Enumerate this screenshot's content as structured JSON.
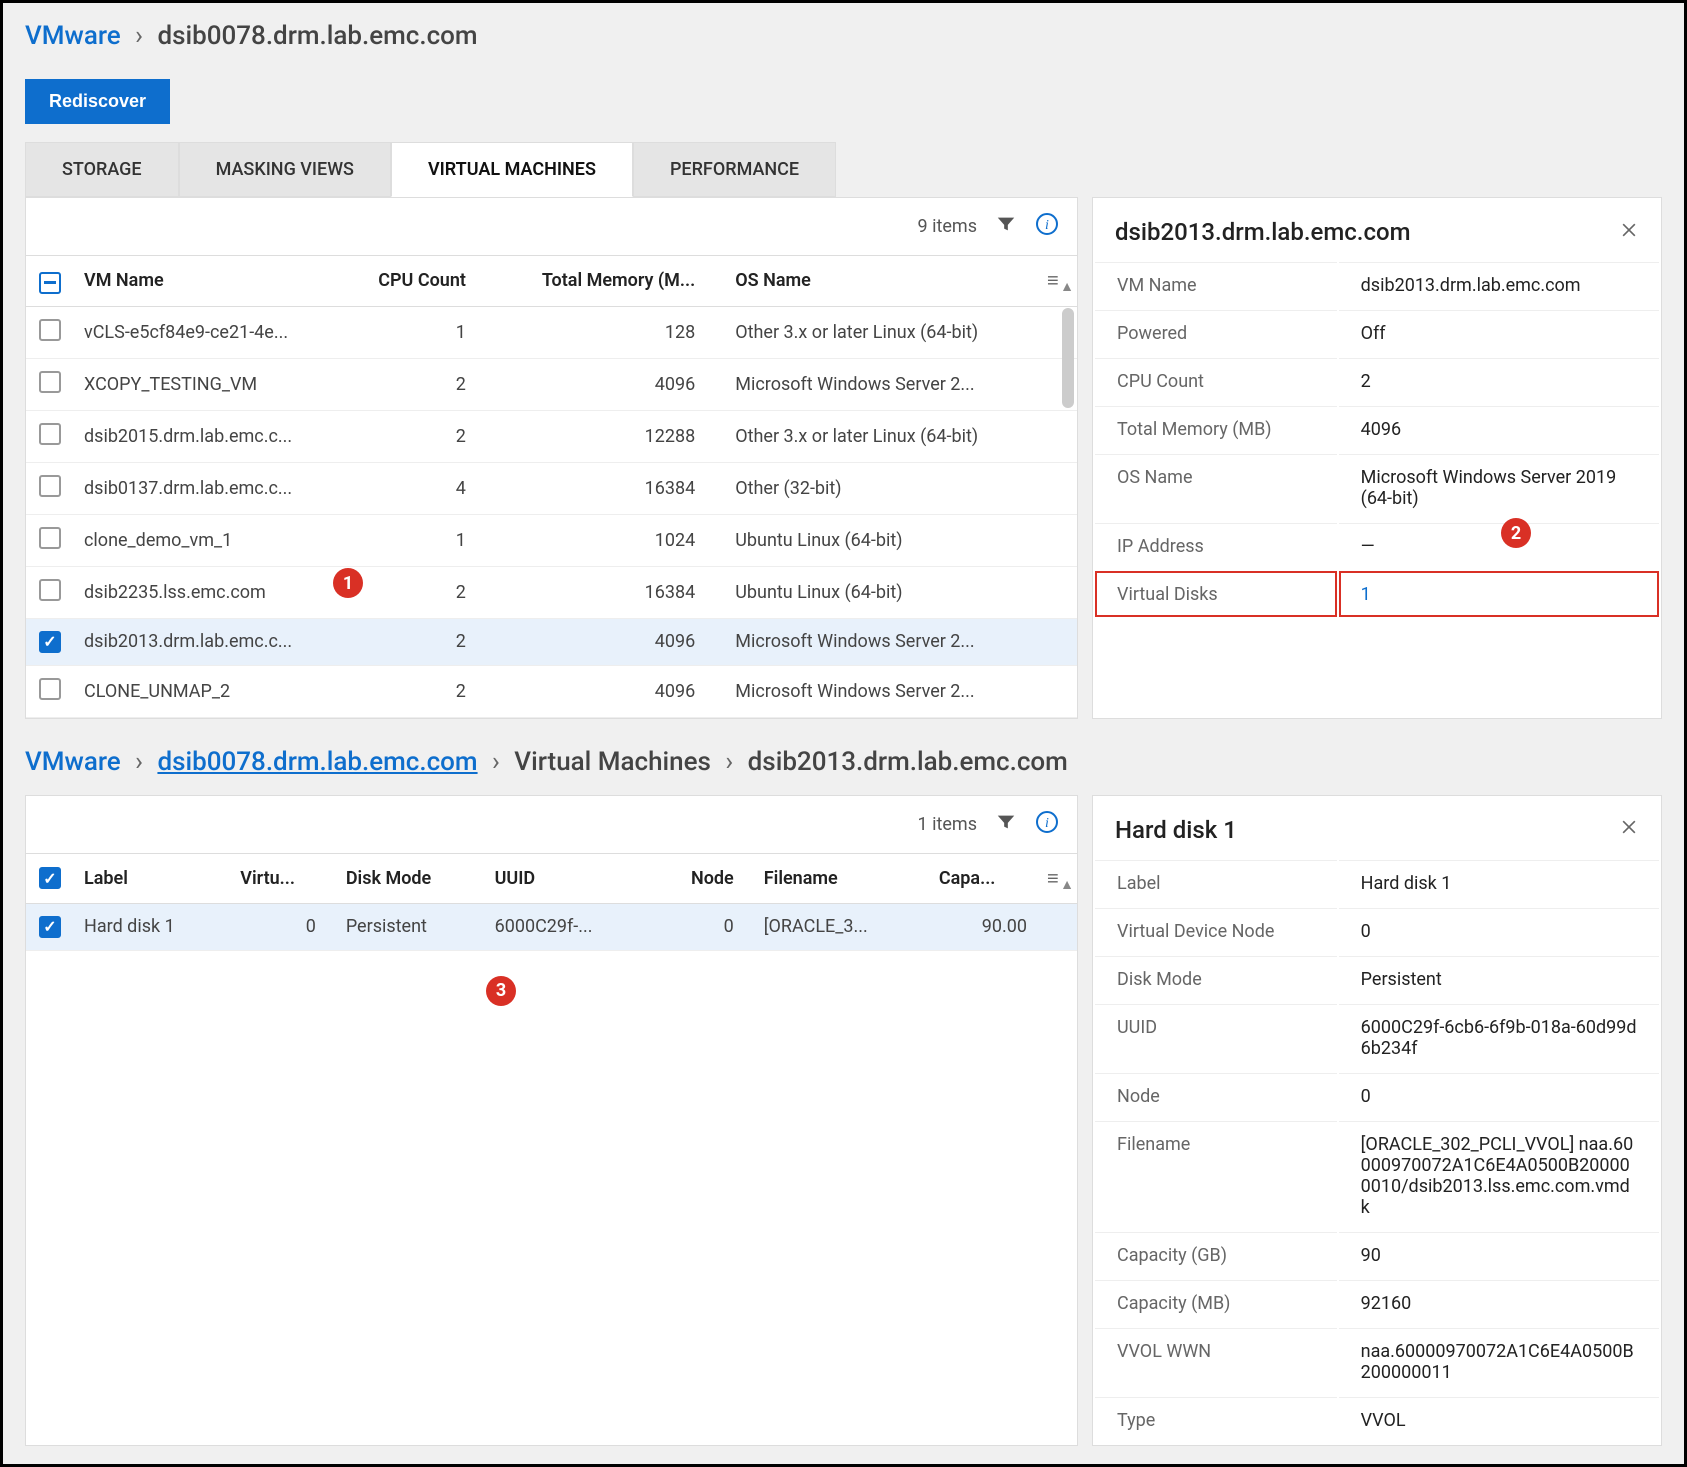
{
  "section1": {
    "breadcrumb": {
      "root": "VMware",
      "host": "dsib0078.drm.lab.emc.com"
    },
    "rediscover": "Rediscover",
    "tabs": {
      "storage": "STORAGE",
      "masking": "MASKING VIEWS",
      "vms": "VIRTUAL MACHINES",
      "perf": "PERFORMANCE"
    },
    "items_count": "9 items",
    "columns": {
      "vm_name": "VM Name",
      "cpu_count": "CPU Count",
      "total_memory": "Total Memory (M...",
      "os_name": "OS Name"
    },
    "rows": [
      {
        "selected": false,
        "vm_name": "vCLS-e5cf84e9-ce21-4e...",
        "cpu": "1",
        "mem": "128",
        "os": "Other 3.x or later Linux (64-bit)"
      },
      {
        "selected": false,
        "vm_name": "XCOPY_TESTING_VM",
        "cpu": "2",
        "mem": "4096",
        "os": "Microsoft Windows Server 2..."
      },
      {
        "selected": false,
        "vm_name": "dsib2015.drm.lab.emc.c...",
        "cpu": "2",
        "mem": "12288",
        "os": "Other 3.x or later Linux (64-bit)"
      },
      {
        "selected": false,
        "vm_name": "dsib0137.drm.lab.emc.c...",
        "cpu": "4",
        "mem": "16384",
        "os": "Other (32-bit)"
      },
      {
        "selected": false,
        "vm_name": "clone_demo_vm_1",
        "cpu": "1",
        "mem": "1024",
        "os": "Ubuntu Linux (64-bit)"
      },
      {
        "selected": false,
        "vm_name": "dsib2235.lss.emc.com",
        "cpu": "2",
        "mem": "16384",
        "os": "Ubuntu Linux (64-bit)"
      },
      {
        "selected": true,
        "vm_name": "dsib2013.drm.lab.emc.c...",
        "cpu": "2",
        "mem": "4096",
        "os": "Microsoft Windows Server 2..."
      },
      {
        "selected": false,
        "vm_name": "CLONE_UNMAP_2",
        "cpu": "2",
        "mem": "4096",
        "os": "Microsoft Windows Server 2..."
      }
    ],
    "detail": {
      "title": "dsib2013.drm.lab.emc.com",
      "fields": {
        "vm_name_label": "VM Name",
        "vm_name_val": "dsib2013.drm.lab.emc.com",
        "powered_label": "Powered",
        "powered_val": "Off",
        "cpu_label": "CPU Count",
        "cpu_val": "2",
        "mem_label": "Total Memory (MB)",
        "mem_val": "4096",
        "os_label": "OS Name",
        "os_val": "Microsoft Windows Server 2019 (64-bit)",
        "ip_label": "IP Address",
        "ip_val": "—",
        "vd_label": "Virtual Disks",
        "vd_val": "1"
      }
    },
    "annotations": {
      "a1": "1",
      "a2": "2"
    }
  },
  "section2": {
    "breadcrumb": {
      "root": "VMware",
      "host": "dsib0078.drm.lab.emc.com",
      "vms": "Virtual Machines",
      "vm": "dsib2013.drm.lab.emc.com"
    },
    "items_count": "1 items",
    "columns": {
      "label": "Label",
      "virt": "Virtu...",
      "disk_mode": "Disk Mode",
      "uuid": "UUID",
      "node": "Node",
      "filename": "Filename",
      "capa": "Capa..."
    },
    "rows": [
      {
        "selected": true,
        "label": "Hard disk 1",
        "virt": "0",
        "disk_mode": "Persistent",
        "uuid": "6000C29f-...",
        "node": "0",
        "filename": "[ORACLE_3...",
        "capa": "90.00"
      }
    ],
    "detail": {
      "title": "Hard disk 1",
      "fields": {
        "label_l": "Label",
        "label_v": "Hard disk 1",
        "vdn_l": "Virtual Device Node",
        "vdn_v": "0",
        "dm_l": "Disk Mode",
        "dm_v": "Persistent",
        "uuid_l": "UUID",
        "uuid_v": "6000C29f-6cb6-6f9b-018a-60d99d6b234f",
        "node_l": "Node",
        "node_v": "0",
        "fn_l": "Filename",
        "fn_v": "[ORACLE_302_PCLI_VVOL] naa.60000970072A1C6E4A0500B200000010/dsib2013.lss.emc.com.vmdk",
        "cgb_l": "Capacity (GB)",
        "cgb_v": "90",
        "cmb_l": "Capacity (MB)",
        "cmb_v": "92160",
        "wwn_l": "VVOL WWN",
        "wwn_v": "naa.60000970072A1C6E4A0500B200000011",
        "type_l": "Type",
        "type_v": "VVOL"
      }
    },
    "annotations": {
      "a3": "3"
    }
  }
}
